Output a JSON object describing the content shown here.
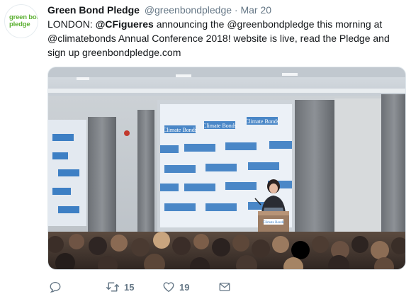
{
  "avatar": {
    "logo_line1": "green bond",
    "logo_line2": "pledge",
    "logo_color": "#5db134"
  },
  "tweet": {
    "name": "Green Bond Pledge",
    "handle": "@greenbondpledge",
    "separator": "·",
    "time": "Mar 20",
    "text": {
      "part1": "LONDON: ",
      "mention1": "@CFigueres",
      "part2": " announcing the @greenbondpledge this morning at @climatebonds Annual Conference 2018! website is live, read the Pledge and sign up greenbondpledge.com"
    }
  },
  "media": {
    "slide_text": "Climate Bonds",
    "podium_text": "Climate Bonds",
    "colors": {
      "slide_accent": "#3d7fc4",
      "screen_bg": "#ecf1f7"
    }
  },
  "actions": {
    "reply_icon": "reply-icon",
    "retweet_icon": "retweet-icon",
    "like_icon": "heart-icon",
    "message_icon": "direct-message-icon",
    "retweet_count": "15",
    "like_count": "19",
    "icon_color": "#657786"
  }
}
